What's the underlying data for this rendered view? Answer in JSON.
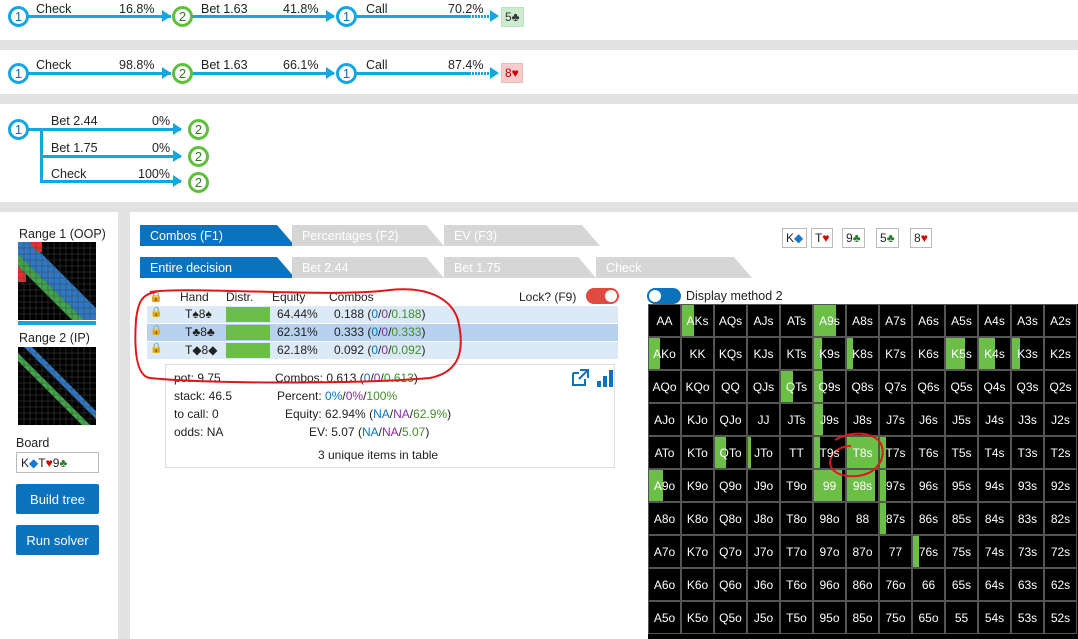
{
  "tree1": {
    "a1": "Check",
    "p1": "16.8%",
    "a2": "Bet 1.63",
    "p2": "41.8%",
    "a3": "Call",
    "p3": "70.2%",
    "card": "5♣",
    "n1": "1",
    "n2": "2",
    "n3": "1"
  },
  "tree2": {
    "a1": "Check",
    "p1": "98.8%",
    "a2": "Bet 1.63",
    "p2": "66.1%",
    "a3": "Call",
    "p3": "87.4%",
    "card": "8♥",
    "n1": "1",
    "n2": "2",
    "n3": "1"
  },
  "tree3": {
    "root": "1",
    "children": [
      {
        "label": "Bet 2.44",
        "pct": "0%",
        "node": "2"
      },
      {
        "label": "Bet 1.75",
        "pct": "0%",
        "node": "2"
      },
      {
        "label": "Check",
        "pct": "100%",
        "node": "2"
      }
    ]
  },
  "left": {
    "range1": "Range 1 (OOP)",
    "range2": "Range 2 (IP)",
    "board_label": "Board",
    "board_k": "K",
    "board_t": "T",
    "board_9": "9",
    "build": "Build tree",
    "run": "Run solver"
  },
  "board_cards": [
    {
      "rank": "K",
      "suit": "◆",
      "color": "#1976d2"
    },
    {
      "rank": "T",
      "suit": "♥",
      "color": "#d50000"
    },
    {
      "rank": "9",
      "suit": "♣",
      "color": "#2e7d32"
    },
    {
      "rank": "5",
      "suit": "♣",
      "color": "#2e7d32"
    },
    {
      "rank": "8",
      "suit": "♥",
      "color": "#d50000"
    }
  ],
  "tabs1": [
    "Combos (F1)",
    "Percentages (F2)",
    "EV (F3)"
  ],
  "tabs2": [
    "Entire decision",
    "Bet 2.44",
    "Bet 1.75",
    "Check"
  ],
  "table": {
    "headers": {
      "hand": "Hand",
      "distr": "Distr.",
      "equity": "Equity",
      "combos": "Combos"
    },
    "lock_label": "Lock? (F9)",
    "rows": [
      {
        "hand": "T♠8♠",
        "equity": "64.44%",
        "c": "0.188",
        "a": "0",
        "b": "0",
        "g": "0.188"
      },
      {
        "hand": "T♣8♣",
        "equity": "62.31%",
        "c": "0.333",
        "a": "0",
        "b": "0",
        "g": "0.333"
      },
      {
        "hand": "T◆8◆",
        "equity": "62.18%",
        "c": "0.092",
        "a": "0",
        "b": "0",
        "g": "0.092"
      }
    ]
  },
  "stats": {
    "pot": "pot: 9.75",
    "stack": "stack: 46.5",
    "tocall": "to call: 0",
    "odds": "odds: NA",
    "combos_label": "Combos:",
    "combos_val": "0.613",
    "combos_a": "0",
    "combos_b": "0",
    "combos_g": "0.613",
    "percent_label": "Percent:",
    "percent_a": "0%",
    "percent_b": "0%",
    "percent_g": "100%",
    "equity_label": "Equity:",
    "equity_val": "62.94%",
    "equity_a": "NA",
    "equity_b": "NA",
    "equity_g": "62.9%",
    "ev_label": "EV:",
    "ev_val": "5.07",
    "ev_a": "NA",
    "ev_b": "NA",
    "ev_g": "5.07",
    "unique": "3 unique items in table"
  },
  "display_method": "Display method 2",
  "grid": {
    "rows": [
      [
        "AA",
        "AKs",
        "AQs",
        "AJs",
        "ATs",
        "A9s",
        "A8s",
        "A7s",
        "A6s",
        "A5s",
        "A4s",
        "A3s",
        "A2s"
      ],
      [
        "AKo",
        "KK",
        "KQs",
        "KJs",
        "KTs",
        "K9s",
        "K8s",
        "K7s",
        "K6s",
        "K5s",
        "K4s",
        "K3s",
        "K2s"
      ],
      [
        "AQo",
        "KQo",
        "QQ",
        "QJs",
        "QTs",
        "Q9s",
        "Q8s",
        "Q7s",
        "Q6s",
        "Q5s",
        "Q4s",
        "Q3s",
        "Q2s"
      ],
      [
        "AJo",
        "KJo",
        "QJo",
        "JJ",
        "JTs",
        "J9s",
        "J8s",
        "J7s",
        "J6s",
        "J5s",
        "J4s",
        "J3s",
        "J2s"
      ],
      [
        "ATo",
        "KTo",
        "QTo",
        "JTo",
        "TT",
        "T9s",
        "T8s",
        "T7s",
        "T6s",
        "T5s",
        "T4s",
        "T3s",
        "T2s"
      ],
      [
        "A9o",
        "K9o",
        "Q9o",
        "J9o",
        "T9o",
        "99",
        "98s",
        "97s",
        "96s",
        "95s",
        "94s",
        "93s",
        "92s"
      ],
      [
        "A8o",
        "K8o",
        "Q8o",
        "J8o",
        "T8o",
        "98o",
        "88",
        "87s",
        "86s",
        "85s",
        "84s",
        "83s",
        "82s"
      ],
      [
        "A7o",
        "K7o",
        "Q7o",
        "J7o",
        "T7o",
        "97o",
        "87o",
        "77",
        "76s",
        "75s",
        "74s",
        "73s",
        "72s"
      ],
      [
        "A6o",
        "K6o",
        "Q6o",
        "J6o",
        "T6o",
        "96o",
        "86o",
        "76o",
        "66",
        "65s",
        "64s",
        "63s",
        "62s"
      ],
      [
        "A5o",
        "K5o",
        "Q5o",
        "J5o",
        "T5o",
        "95o",
        "85o",
        "75o",
        "65o",
        "55",
        "54s",
        "53s",
        "52s"
      ]
    ],
    "fills": [
      [
        0,
        0.4,
        0,
        0,
        0,
        0.7,
        0,
        0,
        0,
        0,
        0,
        0,
        0
      ],
      [
        0.35,
        0,
        0,
        0,
        0,
        0.25,
        0.2,
        0,
        0,
        0.6,
        0.5,
        0.25,
        0
      ],
      [
        0,
        0,
        0,
        0,
        0.4,
        0.3,
        0,
        0,
        0,
        0,
        0,
        0,
        0
      ],
      [
        0,
        0,
        0,
        0,
        0,
        0.3,
        0,
        0,
        0,
        0,
        0,
        0,
        0
      ],
      [
        0,
        0,
        0.35,
        0.1,
        0,
        0.2,
        1.0,
        0.2,
        0,
        0,
        0,
        0,
        0
      ],
      [
        0.45,
        0,
        0,
        0,
        0,
        0.9,
        0.9,
        0.2,
        0,
        0,
        0,
        0,
        0
      ],
      [
        0,
        0,
        0,
        0,
        0,
        0,
        0,
        0.2,
        0,
        0,
        0,
        0,
        0
      ],
      [
        0,
        0,
        0,
        0,
        0,
        0,
        0,
        0,
        0.2,
        0,
        0,
        0,
        0
      ],
      [
        0,
        0,
        0,
        0,
        0,
        0,
        0,
        0,
        0,
        0,
        0,
        0,
        0
      ],
      [
        0,
        0,
        0,
        0,
        0,
        0,
        0,
        0,
        0,
        0,
        0,
        0,
        0
      ]
    ]
  },
  "colors": {
    "accent": "#0b72bd",
    "node1": "#13a6e3",
    "node2": "#5dbf3a",
    "fill": "#6cbf46",
    "annotation": "#e0161b"
  }
}
